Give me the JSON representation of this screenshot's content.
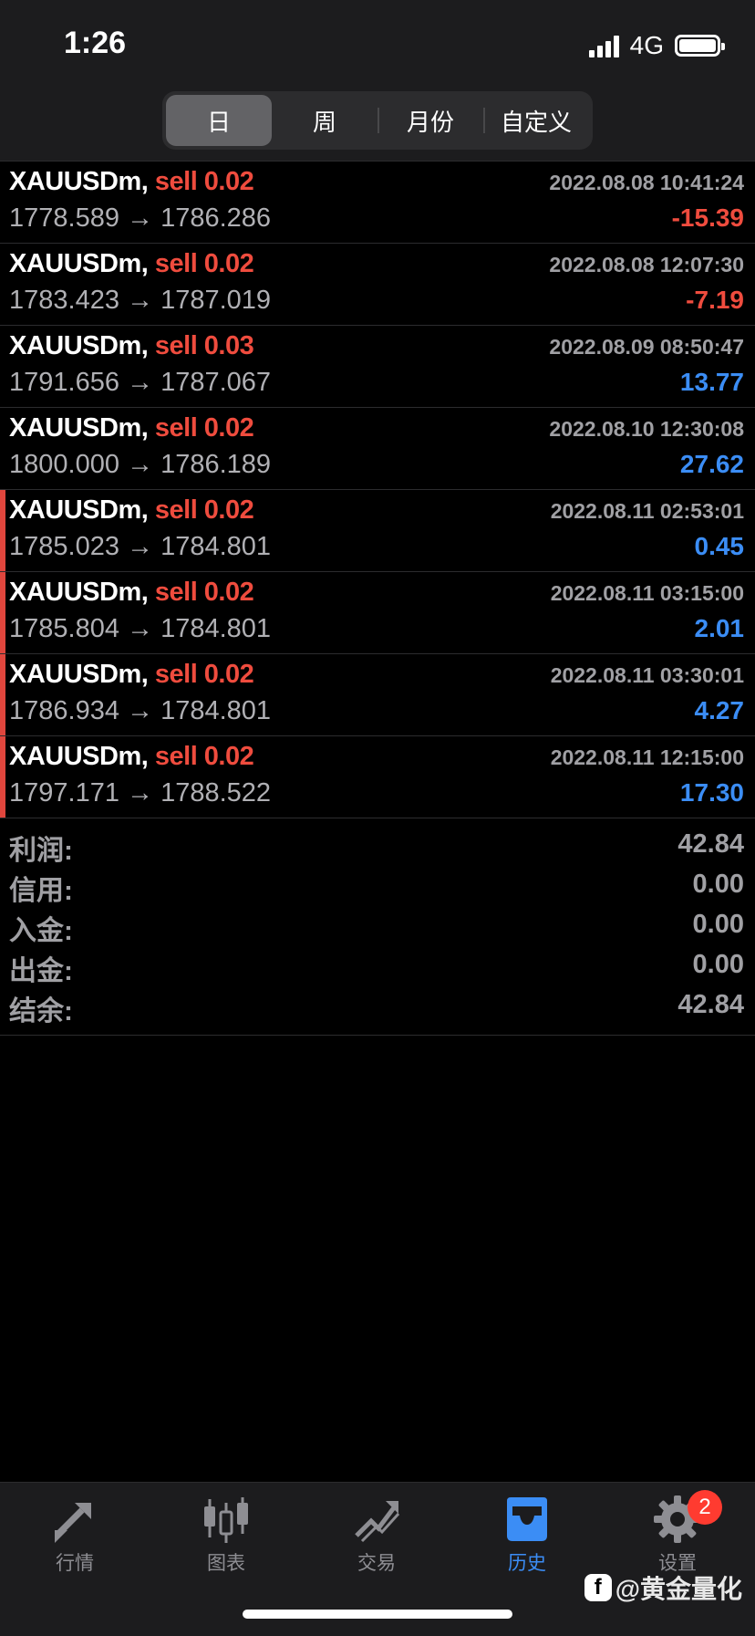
{
  "status": {
    "time": "1:26",
    "network": "4G"
  },
  "tabs": [
    {
      "label": "日",
      "active": true
    },
    {
      "label": "周"
    },
    {
      "label": "月份"
    },
    {
      "label": "自定义"
    }
  ],
  "trades": [
    {
      "symbol": "XAUUSDm,",
      "side": "sell 0.02",
      "datetime": "2022.08.08 10:41:24",
      "prices": "1778.589 → 1786.286",
      "profit": "-15.39",
      "sign": "neg",
      "flag": false
    },
    {
      "symbol": "XAUUSDm,",
      "side": "sell 0.02",
      "datetime": "2022.08.08 12:07:30",
      "prices": "1783.423 → 1787.019",
      "profit": "-7.19",
      "sign": "neg",
      "flag": false
    },
    {
      "symbol": "XAUUSDm,",
      "side": "sell 0.03",
      "datetime": "2022.08.09 08:50:47",
      "prices": "1791.656 → 1787.067",
      "profit": "13.77",
      "sign": "pos",
      "flag": false
    },
    {
      "symbol": "XAUUSDm,",
      "side": "sell 0.02",
      "datetime": "2022.08.10 12:30:08",
      "prices": "1800.000 → 1786.189",
      "profit": "27.62",
      "sign": "pos",
      "flag": false
    },
    {
      "symbol": "XAUUSDm,",
      "side": "sell 0.02",
      "datetime": "2022.08.11 02:53:01",
      "prices": "1785.023 → 1784.801",
      "profit": "0.45",
      "sign": "pos",
      "flag": true
    },
    {
      "symbol": "XAUUSDm,",
      "side": "sell 0.02",
      "datetime": "2022.08.11 03:15:00",
      "prices": "1785.804 → 1784.801",
      "profit": "2.01",
      "sign": "pos",
      "flag": true
    },
    {
      "symbol": "XAUUSDm,",
      "side": "sell 0.02",
      "datetime": "2022.08.11 03:30:01",
      "prices": "1786.934 → 1784.801",
      "profit": "4.27",
      "sign": "pos",
      "flag": true
    },
    {
      "symbol": "XAUUSDm,",
      "side": "sell 0.02",
      "datetime": "2022.08.11 12:15:00",
      "prices": "1797.171 → 1788.522",
      "profit": "17.30",
      "sign": "pos",
      "flag": true
    }
  ],
  "summary": [
    {
      "label": "利润:",
      "value": "42.84"
    },
    {
      "label": "信用:",
      "value": "0.00"
    },
    {
      "label": "入金:",
      "value": "0.00"
    },
    {
      "label": "出金:",
      "value": "0.00"
    },
    {
      "label": "结余:",
      "value": "42.84"
    }
  ],
  "nav": {
    "quotes": "行情",
    "chart": "图表",
    "trade": "交易",
    "history": "历史",
    "settings": "设置",
    "settings_badge": "2"
  },
  "watermark": "@黄金量化",
  "colors": {
    "sell": "#ef4c3e",
    "loss": "#ef4c3e",
    "gain": "#3b8df5",
    "active_tab": "#3b8df5"
  }
}
